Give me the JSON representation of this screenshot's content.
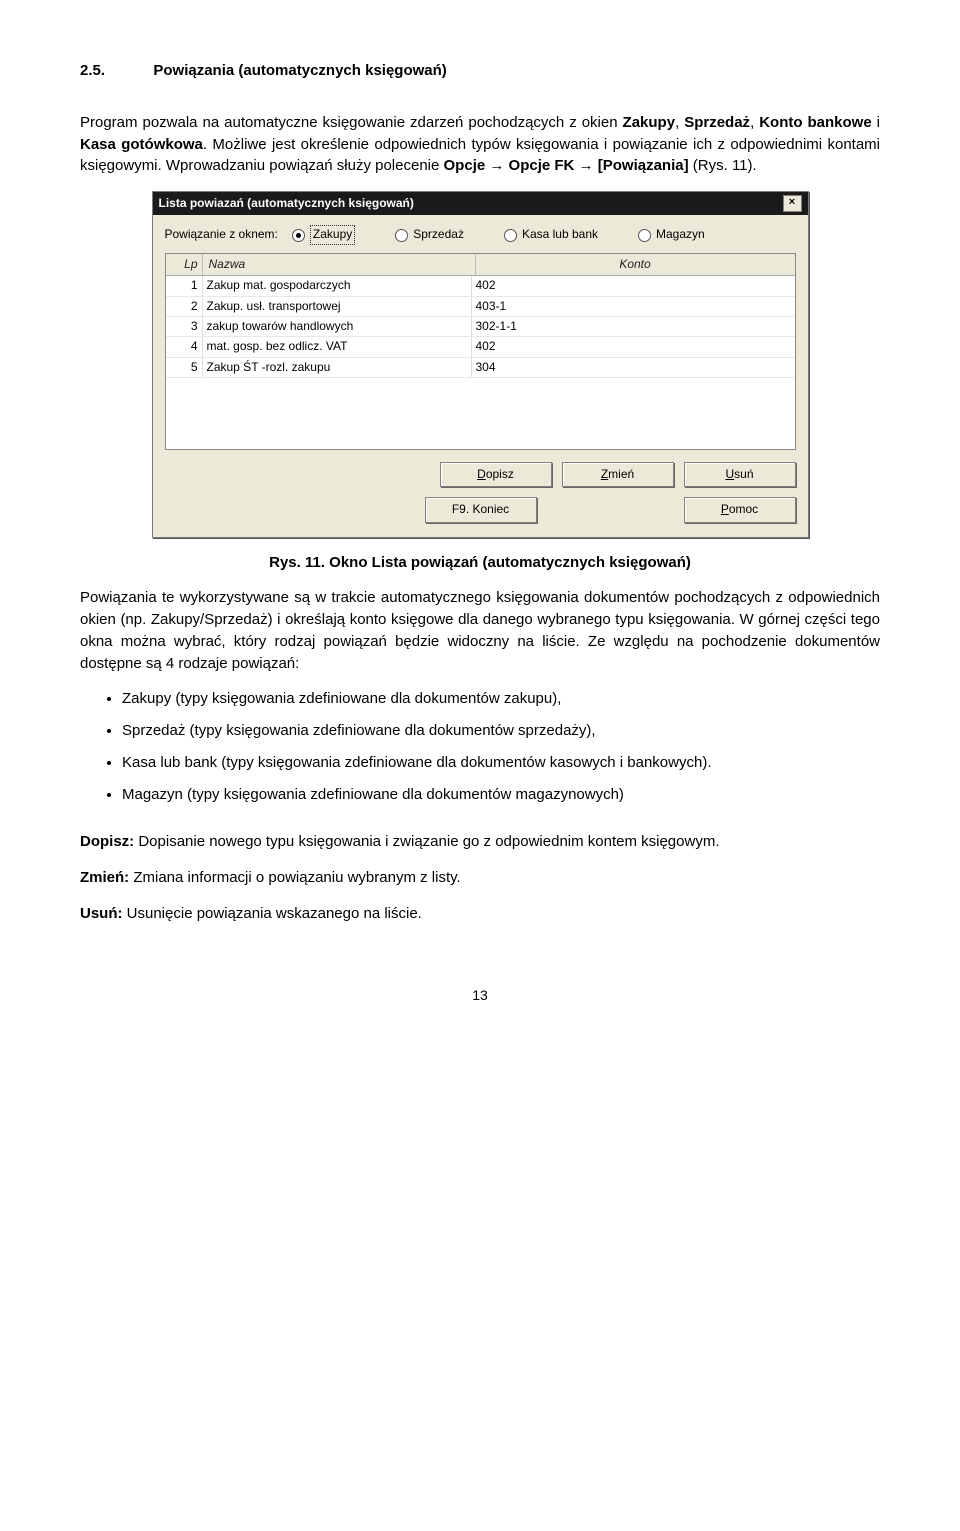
{
  "heading": {
    "num": "2.5.",
    "title": "Powiązania (automatycznych księgowań)"
  },
  "intro": {
    "p1_a": "Program pozwala na automatyczne księgowanie zdarzeń pochodzących z okien ",
    "p1_b1": "Zakupy",
    "p1_c1": ", ",
    "p1_b2": "Sprzedaż",
    "p1_c2": ", ",
    "p1_b3": "Konto bankowe",
    "p1_c3": " i ",
    "p1_b4": "Kasa gotówkowa",
    "p1_d": ". Możliwe jest określenie odpowiednich typów księgowania i powiązanie ich z odpowiednimi kontami księgowymi. Wprowadzaniu powiązań służy polecenie ",
    "p1_e1": "Opcje",
    "p1_arrow1": " → ",
    "p1_e2": "Opcje FK",
    "p1_arrow2": " → ",
    "p1_e3": "[Powiązania]",
    "p1_f": " (Rys. 11)."
  },
  "dialog": {
    "title": "Lista powiazań (automatycznych księgowań)",
    "radio_label": "Powiązanie z oknem:",
    "radios": {
      "r1": "Zakupy",
      "r2": "Sprzedaż",
      "r3": "Kasa lub bank",
      "r4": "Magazyn"
    },
    "header": {
      "lp": "Lp",
      "name": "Nazwa",
      "konto": "Konto"
    },
    "rows": [
      {
        "lp": "1",
        "name": "Zakup mat. gospodarczych",
        "konto": "402"
      },
      {
        "lp": "2",
        "name": "Zakup. usł. transportowej",
        "konto": "403-1"
      },
      {
        "lp": "3",
        "name": "zakup towarów handlowych",
        "konto": "302-1-1"
      },
      {
        "lp": "4",
        "name": "mat. gosp. bez odlicz. VAT",
        "konto": "402"
      },
      {
        "lp": "5",
        "name": "Zakup ŚT -rozl. zakupu",
        "konto": "304"
      }
    ],
    "buttons": {
      "dopisz_u": "D",
      "dopisz_r": "opisz",
      "zmien_u": "Z",
      "zmien_r": "mień",
      "usun_u": "U",
      "usun_r": "suń",
      "koniec": "F9. Koniec",
      "pomoc_u": "P",
      "pomoc_r": "omoc"
    }
  },
  "caption": "Rys. 11. Okno Lista powiązań (automatycznych księgowań)",
  "body": {
    "p2": "Powiązania te wykorzystywane są w trakcie automatycznego księgowania dokumentów pochodzących z odpowiednich okien (np. Zakupy/Sprzedaż) i określają konto księgowe dla danego wybranego typu księgowania. W górnej części tego okna można wybrać, który rodzaj powiązań będzie widoczny na liście. Ze względu na pochodzenie dokumentów dostępne są 4 rodzaje powiązań:",
    "li1": "Zakupy (typy księgowania zdefiniowane dla dokumentów zakupu),",
    "li2": "Sprzedaż (typy księgowania zdefiniowane dla dokumentów sprzedaży),",
    "li3": "Kasa lub bank (typy księgowania zdefiniowane dla dokumentów kasowych i bankowych).",
    "li4": "Magazyn (typy księgowania zdefiniowane dla dokumentów magazynowych)"
  },
  "defs": {
    "d1_label": "Dopisz:",
    "d1_text": " Dopisanie nowego typu księgowania i związanie go z odpowiednim kontem księgowym.",
    "d2_label": "Zmień:",
    "d2_text": " Zmiana informacji o powiązaniu wybranym z listy.",
    "d3_label": "Usuń:",
    "d3_text": " Usunięcie powiązania wskazanego na liście."
  },
  "page": "13"
}
